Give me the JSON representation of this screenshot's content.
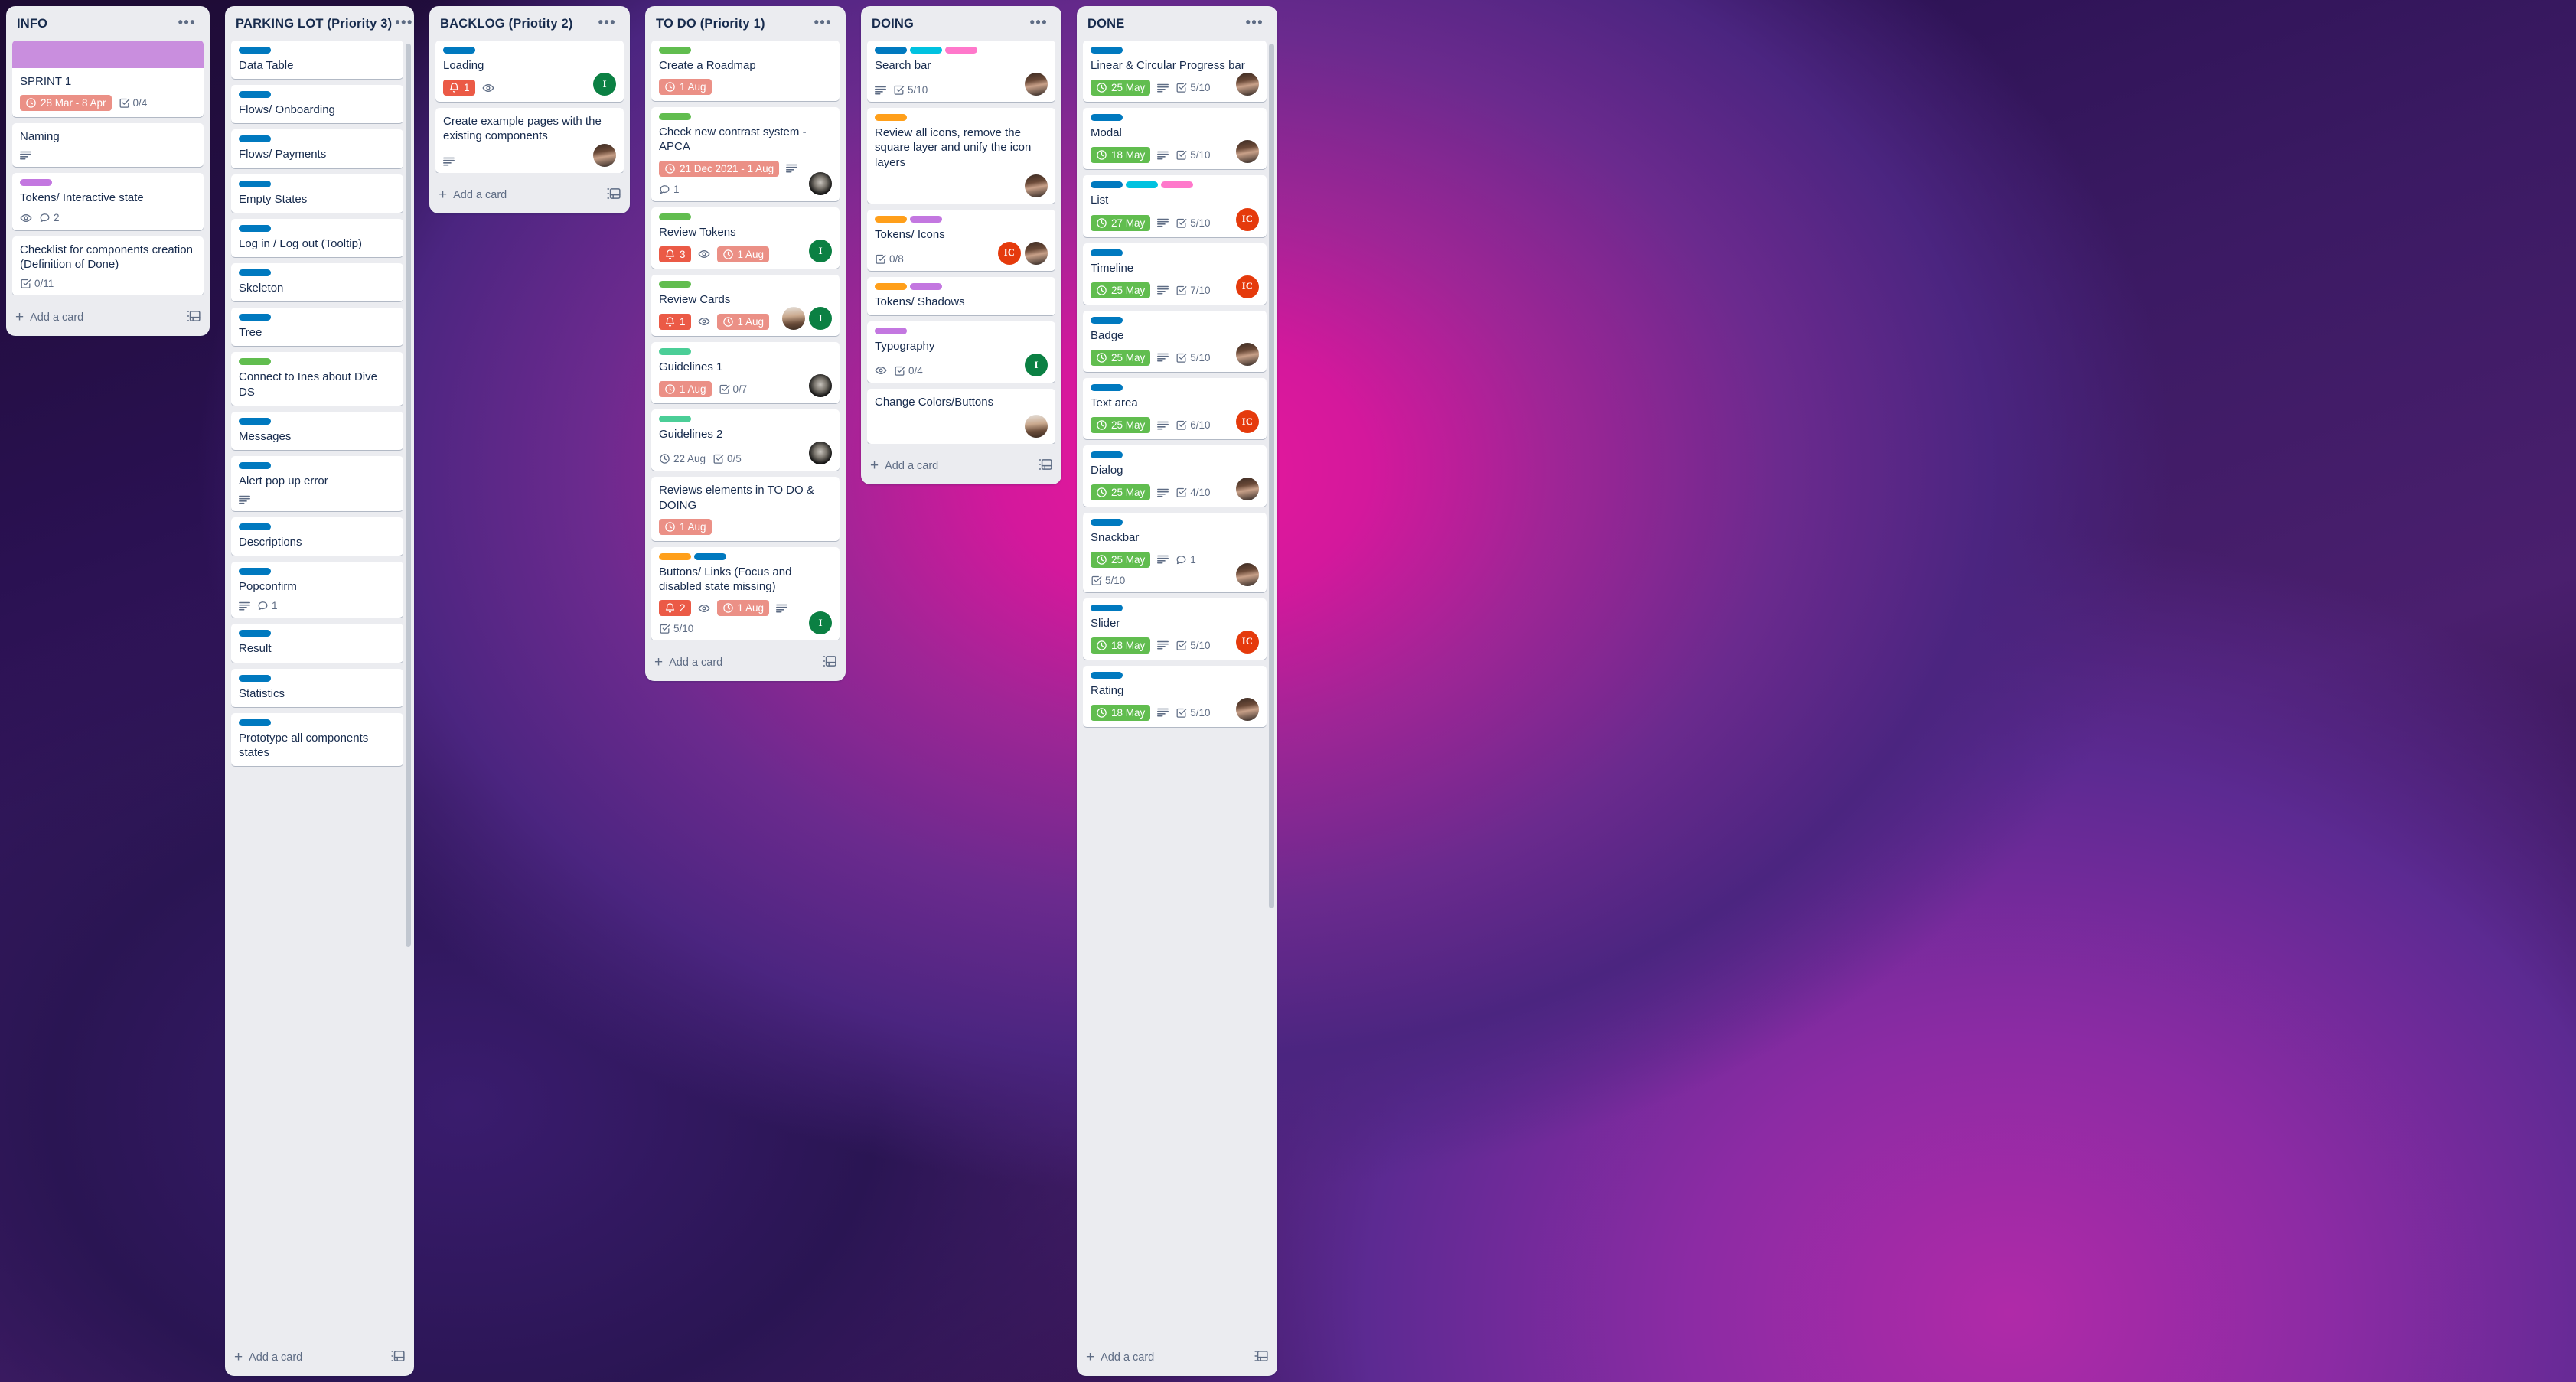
{
  "board": {
    "add_card_label": "Add a card",
    "menu_glyph": "•••"
  },
  "label_colors": {
    "blue": "#0079bf",
    "green": "#61bd4f",
    "green_light": "#4bce97",
    "orange": "#ff9f1a",
    "purple": "#c377e0",
    "sky": "#00c2e0",
    "pink": "#ff78cb"
  },
  "columns": [
    {
      "id": "info",
      "title": "INFO",
      "cards": [
        {
          "title": "SPRINT 1",
          "cover": "#c98ede",
          "labels": [],
          "due": {
            "text": "28 Mar - 8 Apr",
            "state": "due"
          },
          "checklist": "0/4",
          "members": []
        },
        {
          "title": "Naming",
          "labels": [],
          "description": true,
          "members": []
        },
        {
          "title": "Tokens/ Interactive state",
          "labels": [
            "purple"
          ],
          "watching": true,
          "comments": "2",
          "members": []
        },
        {
          "title": "Checklist for components creation (Definition of Done)",
          "labels": [],
          "checklist": "0/11",
          "members": []
        }
      ]
    },
    {
      "id": "parking-lot",
      "title": "PARKING LOT (Priority 3)",
      "cards": [
        {
          "title": "Data Table",
          "labels": [
            "blue"
          ]
        },
        {
          "title": "Flows/ Onboarding",
          "labels": [
            "blue"
          ]
        },
        {
          "title": "Flows/ Payments",
          "labels": [
            "blue"
          ]
        },
        {
          "title": "Empty States",
          "labels": [
            "blue"
          ]
        },
        {
          "title": "Log in / Log out (Tooltip)",
          "labels": [
            "blue"
          ]
        },
        {
          "title": "Skeleton",
          "labels": [
            "blue"
          ]
        },
        {
          "title": "Tree",
          "labels": [
            "blue"
          ]
        },
        {
          "title": "Connect to Ines about Dive DS",
          "labels": [
            "green"
          ]
        },
        {
          "title": "Messages",
          "labels": [
            "blue"
          ]
        },
        {
          "title": "Alert pop up error",
          "labels": [
            "blue"
          ],
          "description": true
        },
        {
          "title": "Descriptions",
          "labels": [
            "blue"
          ]
        },
        {
          "title": "Popconfirm",
          "labels": [
            "blue"
          ],
          "description": true,
          "comments": "1"
        },
        {
          "title": "Result",
          "labels": [
            "blue"
          ]
        },
        {
          "title": "Statistics",
          "labels": [
            "blue"
          ]
        },
        {
          "title": "Prototype all components states",
          "labels": [
            "blue"
          ]
        }
      ]
    },
    {
      "id": "backlog",
      "title": "BACKLOG (Priotity 2)",
      "cards": [
        {
          "title": "Loading",
          "labels": [
            "blue"
          ],
          "alert": "1",
          "watching": true,
          "members": [
            {
              "type": "initial",
              "text": "I",
              "style": "av-green"
            }
          ]
        },
        {
          "title": "Create example pages with the existing components",
          "labels": [],
          "description": true,
          "members": [
            {
              "type": "photo",
              "style": "av-photo-1"
            }
          ]
        }
      ]
    },
    {
      "id": "todo",
      "title": "TO DO (Priority 1)",
      "cards": [
        {
          "title": "Create a Roadmap",
          "labels": [
            "green"
          ],
          "due": {
            "text": "1 Aug",
            "state": "due"
          }
        },
        {
          "title": "Check new contrast system - APCA",
          "labels": [
            "green"
          ],
          "due": {
            "text": "21 Dec 2021 - 1 Aug",
            "state": "due"
          },
          "description": true,
          "comments": "1",
          "members": [
            {
              "type": "photo",
              "style": "av-photo-3"
            }
          ]
        },
        {
          "title": "Review Tokens",
          "labels": [
            "green"
          ],
          "alert": "3",
          "watching": true,
          "due": {
            "text": "1 Aug",
            "state": "due"
          },
          "members": [
            {
              "type": "initial",
              "text": "I",
              "style": "av-green"
            }
          ]
        },
        {
          "title": "Review Cards",
          "labels": [
            "green"
          ],
          "alert": "1",
          "watching": true,
          "due": {
            "text": "1 Aug",
            "state": "due"
          },
          "members": [
            {
              "type": "photo",
              "style": "av-photo-2"
            },
            {
              "type": "initial",
              "text": "I",
              "style": "av-green"
            }
          ]
        },
        {
          "title": "Guidelines 1",
          "labels": [
            "green_light"
          ],
          "due": {
            "text": "1 Aug",
            "state": "due"
          },
          "checklist": "0/7",
          "members": [
            {
              "type": "photo",
              "style": "av-photo-3"
            }
          ]
        },
        {
          "title": "Guidelines 2",
          "labels": [
            "green_light"
          ],
          "due_plain": "22 Aug",
          "checklist": "0/5",
          "members": [
            {
              "type": "photo",
              "style": "av-photo-3"
            }
          ]
        },
        {
          "title": "Reviews elements in TO DO & DOING",
          "labels": [],
          "due": {
            "text": "1 Aug",
            "state": "due"
          }
        },
        {
          "title": "Buttons/ Links (Focus and disabled state missing)",
          "labels": [
            "orange",
            "blue"
          ],
          "alert": "2",
          "watching": true,
          "due": {
            "text": "1 Aug",
            "state": "due"
          },
          "description": true,
          "checklist": "5/10",
          "members": [
            {
              "type": "initial",
              "text": "I",
              "style": "av-green"
            }
          ]
        }
      ]
    },
    {
      "id": "doing",
      "title": "DOING",
      "cards": [
        {
          "title": "Search bar",
          "labels": [
            "blue",
            "sky",
            "pink"
          ],
          "description": true,
          "checklist": "5/10",
          "members": [
            {
              "type": "photo",
              "style": "av-photo-1"
            }
          ]
        },
        {
          "title": "Review all icons, remove the square layer and unify the icon layers",
          "labels": [
            "orange"
          ],
          "members": [
            {
              "type": "photo",
              "style": "av-photo-1"
            }
          ]
        },
        {
          "title": "Tokens/ Icons",
          "labels": [
            "orange",
            "purple"
          ],
          "checklist": "0/8",
          "members": [
            {
              "type": "initial",
              "text": "IC",
              "style": "av-red"
            },
            {
              "type": "photo",
              "style": "av-photo-1"
            }
          ]
        },
        {
          "title": "Tokens/ Shadows",
          "labels": [
            "orange",
            "purple"
          ]
        },
        {
          "title": "Typography",
          "labels": [
            "purple"
          ],
          "watching": true,
          "checklist": "0/4",
          "members": [
            {
              "type": "initial",
              "text": "I",
              "style": "av-green"
            }
          ]
        },
        {
          "title": "Change Colors/Buttons",
          "labels": [],
          "members": [
            {
              "type": "photo",
              "style": "av-photo-2"
            }
          ]
        }
      ]
    },
    {
      "id": "done",
      "title": "DONE",
      "cards": [
        {
          "title": "Linear & Circular Progress bar",
          "labels": [
            "blue"
          ],
          "due": {
            "text": "25 May",
            "state": "done"
          },
          "description": true,
          "checklist": "5/10",
          "members": [
            {
              "type": "photo",
              "style": "av-photo-1"
            }
          ]
        },
        {
          "title": "Modal",
          "labels": [
            "blue"
          ],
          "due": {
            "text": "18 May",
            "state": "done"
          },
          "description": true,
          "checklist": "5/10",
          "members": [
            {
              "type": "photo",
              "style": "av-photo-1"
            }
          ]
        },
        {
          "title": "List",
          "labels": [
            "blue",
            "sky",
            "pink"
          ],
          "due": {
            "text": "27 May",
            "state": "done"
          },
          "description": true,
          "checklist": "5/10",
          "members": [
            {
              "type": "initial",
              "text": "IC",
              "style": "av-red"
            }
          ]
        },
        {
          "title": "Timeline",
          "labels": [
            "blue"
          ],
          "due": {
            "text": "25 May",
            "state": "done"
          },
          "description": true,
          "checklist": "7/10",
          "members": [
            {
              "type": "initial",
              "text": "IC",
              "style": "av-red"
            }
          ]
        },
        {
          "title": "Badge",
          "labels": [
            "blue"
          ],
          "due": {
            "text": "25 May",
            "state": "done"
          },
          "description": true,
          "checklist": "5/10",
          "members": [
            {
              "type": "photo",
              "style": "av-photo-1"
            }
          ]
        },
        {
          "title": "Text area",
          "labels": [
            "blue"
          ],
          "due": {
            "text": "25 May",
            "state": "done"
          },
          "description": true,
          "checklist": "6/10",
          "members": [
            {
              "type": "initial",
              "text": "IC",
              "style": "av-red"
            }
          ]
        },
        {
          "title": "Dialog",
          "labels": [
            "blue"
          ],
          "due": {
            "text": "25 May",
            "state": "done"
          },
          "description": true,
          "checklist": "4/10",
          "members": [
            {
              "type": "photo",
              "style": "av-photo-1"
            }
          ]
        },
        {
          "title": "Snackbar",
          "labels": [
            "blue"
          ],
          "due": {
            "text": "25 May",
            "state": "done"
          },
          "description": true,
          "comments": "1",
          "checklist": "5/10",
          "members": [
            {
              "type": "photo",
              "style": "av-photo-1"
            }
          ]
        },
        {
          "title": "Slider",
          "labels": [
            "blue"
          ],
          "due": {
            "text": "18 May",
            "state": "done"
          },
          "description": true,
          "checklist": "5/10",
          "members": [
            {
              "type": "initial",
              "text": "IC",
              "style": "av-red"
            }
          ]
        },
        {
          "title": "Rating",
          "labels": [
            "blue"
          ],
          "due": {
            "text": "18 May",
            "state": "done"
          },
          "description": true,
          "checklist": "5/10",
          "members": [
            {
              "type": "photo",
              "style": "av-photo-1"
            }
          ]
        }
      ]
    }
  ]
}
